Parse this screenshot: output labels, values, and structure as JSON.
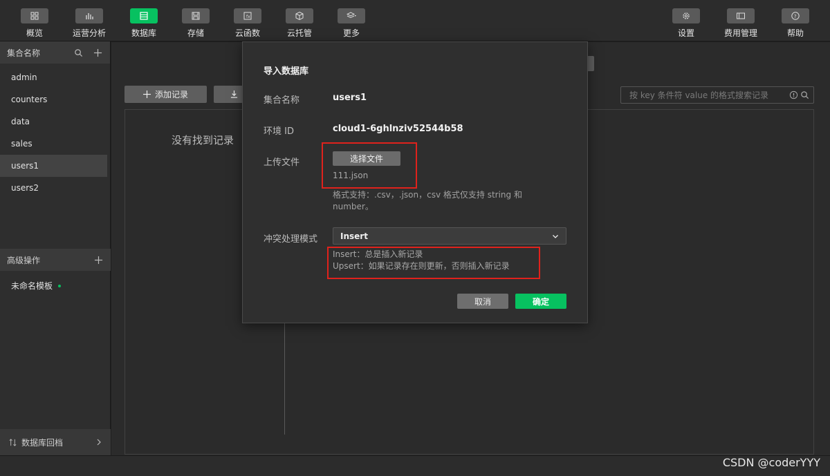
{
  "toolbar": {
    "left": [
      {
        "label": "概览",
        "icon": "grid-icon"
      },
      {
        "label": "运营分析",
        "icon": "bar-chart-icon"
      },
      {
        "label": "数据库",
        "icon": "database-icon",
        "active": true
      },
      {
        "label": "存储",
        "icon": "save-icon"
      },
      {
        "label": "云函数",
        "icon": "function-icon"
      },
      {
        "label": "云托管",
        "icon": "cube-icon"
      },
      {
        "label": "更多",
        "icon": "layers-icon"
      }
    ],
    "right": [
      {
        "label": "设置",
        "icon": "gear-icon"
      },
      {
        "label": "费用管理",
        "icon": "billing-icon"
      },
      {
        "label": "帮助",
        "icon": "help-icon"
      }
    ]
  },
  "sidebar": {
    "collections_title": "集合名称",
    "collections": [
      "admin",
      "counters",
      "data",
      "sales",
      "users1",
      "users2"
    ],
    "active_collection": "users1",
    "advanced_title": "高级操作",
    "template": "未命名模板",
    "footer": "数据库回档"
  },
  "main": {
    "add_record": "添加记录",
    "search_placeholder": "按 key 条件符 value 的格式搜索记录",
    "empty_text": "没有找到记录"
  },
  "modal": {
    "title": "导入数据库",
    "collection_label": "集合名称",
    "collection_value": "users1",
    "env_label": "环境 ID",
    "env_value": "cloud1-6ghlnziv52544b58",
    "upload_label": "上传文件",
    "choose_file": "选择文件",
    "file_name": "111.json",
    "format_hint": "格式支持：.csv，.json，csv 格式仅支持 string 和 number。",
    "conflict_label": "冲突处理模式",
    "conflict_value": "Insert",
    "insert_desc": "Insert：总是插入新记录",
    "upsert_desc": "Upsert：如果记录存在则更新，否则插入新记录",
    "cancel": "取消",
    "confirm": "确定"
  },
  "watermark": "CSDN @coderYYY",
  "colors": {
    "accent": "#07c160",
    "highlight": "#e0221c"
  }
}
